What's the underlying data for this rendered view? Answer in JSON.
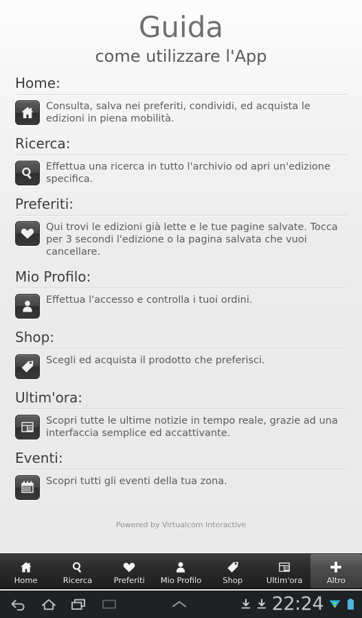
{
  "header": {
    "title": "Guida",
    "subtitle": "come utilizzare l'App"
  },
  "sections": [
    {
      "heading": "Home:",
      "icon": "home-icon",
      "text": "Consulta, salva nei preferiti, condividi, ed acquista le edizioni in piena mobilità."
    },
    {
      "heading": "Ricerca:",
      "icon": "search-icon",
      "text": "Effettua una ricerca in tutto l'archivio od apri un'edizione specifica."
    },
    {
      "heading": "Preferiti:",
      "icon": "heart-icon",
      "text": "Qui trovi le edizioni già lette e le tue pagine salvate. Tocca per 3 secondi l'edizione o la pagina salvata che vuoi cancellare."
    },
    {
      "heading": "Mio Profilo:",
      "icon": "person-icon",
      "text": "Effettua l'accesso e controlla i tuoi ordini."
    },
    {
      "heading": "Shop:",
      "icon": "tag-icon",
      "text": "Scegli ed acquista il prodotto che preferisci."
    },
    {
      "heading": "Ultim'ora:",
      "icon": "newspaper-icon",
      "text": "Scopri tutte le ultime notizie in tempo reale, grazie ad una interfaccia semplice ed accattivante."
    },
    {
      "heading": "Eventi:",
      "icon": "calendar-icon",
      "text": "Scopri tutti gli eventi della tua zona."
    }
  ],
  "footer": {
    "credit": "Powered by Virtualcom Interactive"
  },
  "tabbar": {
    "tabs": [
      {
        "label": "Home",
        "icon": "home-icon",
        "selected": false
      },
      {
        "label": "Ricerca",
        "icon": "search-icon",
        "selected": false
      },
      {
        "label": "Preferiti",
        "icon": "heart-icon",
        "selected": false
      },
      {
        "label": "Mio Profilo",
        "icon": "person-icon",
        "selected": false
      },
      {
        "label": "Shop",
        "icon": "tag-icon",
        "selected": false
      },
      {
        "label": "Ultim'ora",
        "icon": "newspaper-icon",
        "selected": false
      },
      {
        "label": "Altro",
        "icon": "plus-icon",
        "selected": true
      }
    ]
  },
  "systembar": {
    "nav": [
      "back-icon",
      "home-icon",
      "recents-icon",
      "screenshot-icon"
    ],
    "center": "chevron-up-icon",
    "status_icons": [
      "download-icon",
      "download-icon"
    ],
    "time": "22:24",
    "tray_icons": [
      "wifi-icon",
      "battery-icon"
    ]
  },
  "colors": {
    "background": "#eaeaea",
    "title": "#6f6f6f",
    "heading": "#3c3c3c",
    "body_text": "#5b5b5b",
    "tabbar": "#2b2b2b",
    "systembar": "#1f2225",
    "battery": "#50b5e0"
  }
}
